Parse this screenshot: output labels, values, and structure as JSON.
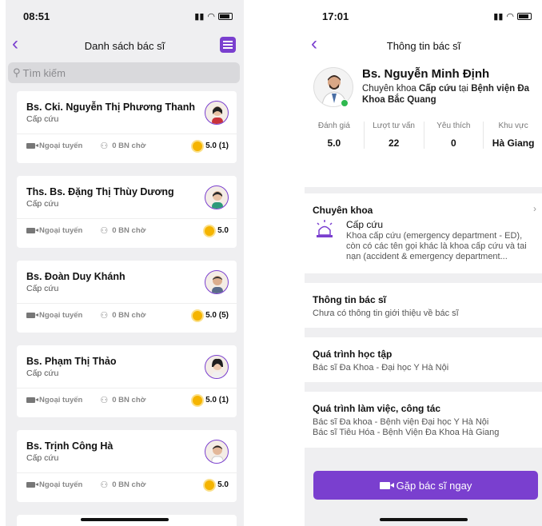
{
  "left_screen": {
    "status_time": "08:51",
    "title": "Danh sách bác sĩ",
    "search_placeholder": "Tìm kiếm",
    "doctors": [
      {
        "name": "Bs. Cki. Nguyễn Thị Phương Thanh",
        "specialty": "Cấp cứu",
        "status": "Ngoại tuyến",
        "waiting": "0 BN chờ",
        "rating": "5.0 (1)"
      },
      {
        "name": "Ths. Bs. Đặng Thị Thùy Dương",
        "specialty": "Cấp cứu",
        "status": "Ngoại tuyến",
        "waiting": "0 BN chờ",
        "rating": "5.0"
      },
      {
        "name": "Bs. Đoàn Duy Khánh",
        "specialty": "Cấp cứu",
        "status": "Ngoại tuyến",
        "waiting": "0 BN chờ",
        "rating": "5.0 (5)"
      },
      {
        "name": "Bs. Phạm Thị Thảo",
        "specialty": "Cấp cứu",
        "status": "Ngoại tuyến",
        "waiting": "0 BN chờ",
        "rating": "5.0 (1)"
      },
      {
        "name": "Bs. Trịnh Công Hà",
        "specialty": "Cấp cứu",
        "status": "Ngoại tuyến",
        "waiting": "0 BN chờ",
        "rating": "5.0"
      }
    ]
  },
  "right_screen": {
    "status_time": "17:01",
    "title": "Thông tin bác sĩ",
    "doctor_name": "Bs. Nguyễn Minh Định",
    "desc_prefix": "Chuyên khoa ",
    "desc_specialty": "Cấp cứu",
    "desc_mid": " tại ",
    "desc_hospital": "Bệnh viện Đa Khoa Bắc Quang",
    "stats": [
      {
        "label": "Đánh giá",
        "value": "5.0"
      },
      {
        "label": "Lượt tư vấn",
        "value": "22"
      },
      {
        "label": "Yêu thích",
        "value": "0"
      },
      {
        "label": "Khu vực",
        "value": "Hà Giang"
      }
    ],
    "specialty_section": {
      "title": "Chuyên khoa",
      "name": "Cấp cứu",
      "description": "Khoa cấp cứu (emergency department - ED), còn có các tên gọi khác là khoa cấp cứu và tai nạn (accident & emergency department..."
    },
    "info_section": {
      "title": "Thông tin bác sĩ",
      "body": "Chưa có thông tin giới thiệu về bác sĩ"
    },
    "education_section": {
      "title": "Quá trình học tập",
      "body": "Bác sĩ Đa Khoa - Đại học Y Hà Nội"
    },
    "work_section": {
      "title": "Quá trình làm việc, công tác",
      "line1": "Bác sĩ Đa khoa - Bệnh viện Đại học Y Hà Nội",
      "line2": "Bác sĩ Tiêu Hóa - Bệnh Viện Đa Khoa Hà Giang"
    },
    "cta_label": "Gặp bác sĩ ngay"
  },
  "colors": {
    "accent": "#7a3fcf",
    "online": "#2fb84f",
    "rating_sun": "#f5b400"
  }
}
